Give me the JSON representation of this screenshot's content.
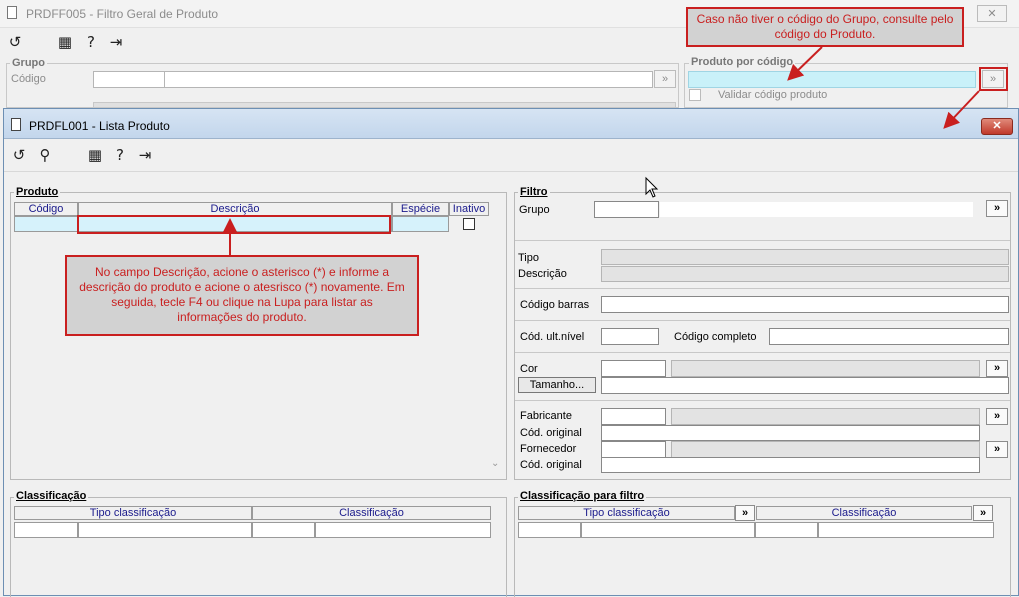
{
  "background_window": {
    "title": "PRDFF005 - Filtro Geral de Produto",
    "close_glyph": "✕",
    "grupo": {
      "label": "Grupo",
      "codigo_label": "Código"
    },
    "produto_por_codigo": {
      "label": "Produto por código",
      "validar_label": "Validar código produto"
    },
    "lookup_glyph": "»"
  },
  "annotations": {
    "top_callout": "Caso não tiver o código do Grupo, consulte pelo código do Produto.",
    "middle_callout": "No campo Descrição, acione o asterisco (*) e informe a descrição do produto e acione o atesrisco (*) novamente. Em seguida, tecle F4 ou clique na Lupa para listar as informações do produto."
  },
  "front_window": {
    "title": "PRDFL001 - Lista Produto",
    "close_glyph": "✕",
    "produto": {
      "label": "Produto",
      "columns": [
        "Código",
        "Descrição",
        "Espécie",
        "Inativo"
      ]
    },
    "filtro": {
      "label": "Filtro",
      "grupo_label": "Grupo",
      "tipo_label": "Tipo",
      "descricao_label": "Descrição",
      "codigo_barras_label": "Código barras",
      "cod_ult_nivel_label": "Cód. ult.nível",
      "codigo_completo_label": "Código completo",
      "cor_label": "Cor",
      "tamanho_button": "Tamanho...",
      "fabricante_label": "Fabricante",
      "cod_original_label": "Cód. original",
      "fornecedor_label": "Fornecedor",
      "cod_original2_label": "Cód. original",
      "lookup_glyph": "»"
    },
    "classificacao": {
      "label": "Classificação",
      "columns": [
        "Tipo classificação",
        "Classificação"
      ]
    },
    "classificacao_filtro": {
      "label": "Classificação para filtro",
      "columns": [
        "Tipo classificação",
        "Classificação"
      ]
    }
  },
  "colors": {
    "accent_red": "#c91f1f",
    "selection_cyan": "#d6f2fb",
    "title_blue": "#c3d6ec"
  }
}
